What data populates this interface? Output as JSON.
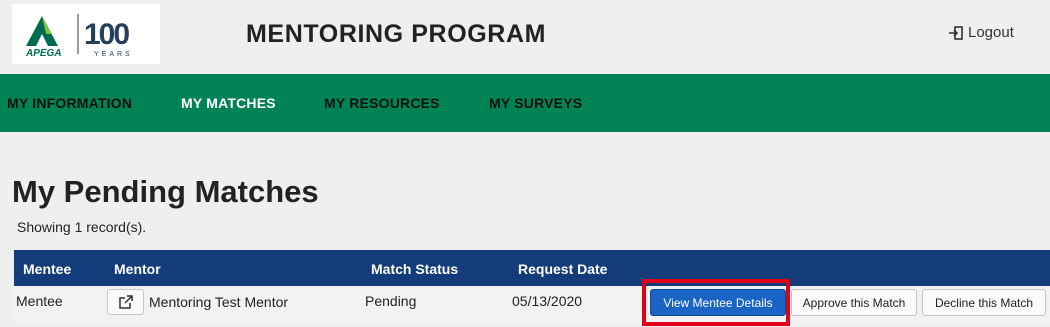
{
  "header": {
    "logo_text_left": "APEGA",
    "logo_text_right": "100",
    "logo_subtext": "YEARS",
    "app_title": "MENTORING PROGRAM",
    "logout_label": "Logout"
  },
  "nav": {
    "items": [
      {
        "label": "MY INFORMATION",
        "active": false
      },
      {
        "label": "MY MATCHES",
        "active": true
      },
      {
        "label": "MY RESOURCES",
        "active": false
      },
      {
        "label": "MY SURVEYS",
        "active": false
      }
    ]
  },
  "page": {
    "title": "My Pending Matches",
    "record_count": "Showing 1 record(s)."
  },
  "table": {
    "columns": [
      "Mentee",
      "Mentor",
      "Match Status",
      "Request Date"
    ],
    "rows": [
      {
        "mentee": "Mentee",
        "mentor": "Mentoring Test Mentor",
        "status": "Pending",
        "request_date": "05/13/2020",
        "actions": {
          "view": "View Mentee Details",
          "approve": "Approve this Match",
          "decline": "Decline this Match"
        }
      }
    ]
  },
  "colors": {
    "nav_bg": "#008257",
    "table_header_bg": "#143c7a",
    "primary_button": "#1a64c6",
    "highlight_border": "#e0001a"
  },
  "icons": {
    "logout": "logout-icon",
    "external_link": "external-link-icon"
  }
}
